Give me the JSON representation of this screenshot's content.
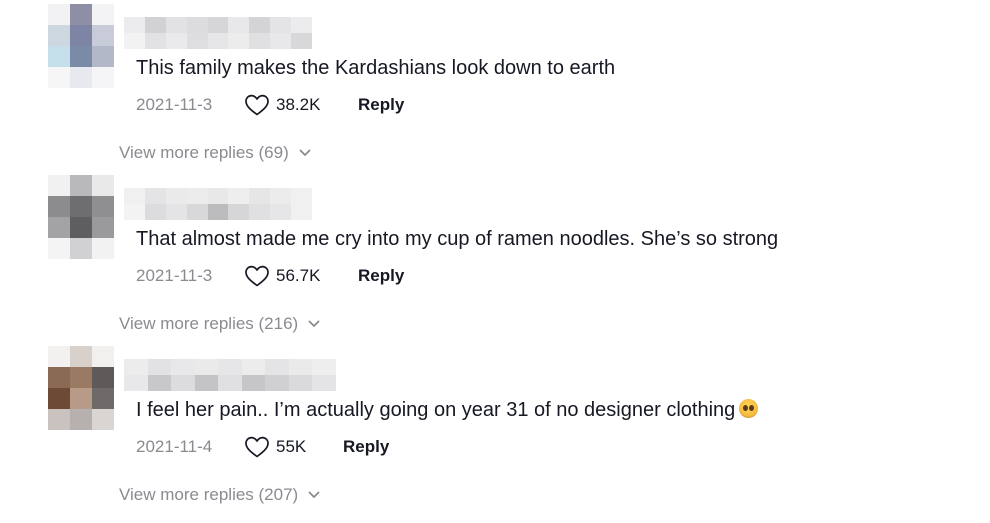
{
  "colors": {
    "text_primary": "#161823",
    "text_secondary": "#8a8b91",
    "background": "#ffffff"
  },
  "comments": [
    {
      "text": "This family makes the Kardashians look down to earth",
      "date": "2021-11-3",
      "likes": "38.2K",
      "reply_label": "Reply",
      "view_more_label": "View more replies (69)",
      "username_redacted": true,
      "avatar_redacted": true
    },
    {
      "text": "That almost made me cry into my cup of ramen noodles. She’s so strong",
      "date": "2021-11-3",
      "likes": "56.7K",
      "reply_label": "Reply",
      "view_more_label": "View more replies (216)",
      "username_redacted": true,
      "avatar_redacted": true
    },
    {
      "text": "I feel her pain.. I’m actually going on year 31 of no designer clothing",
      "emoji": "pleading-face",
      "date": "2021-11-4",
      "likes": "55K",
      "reply_label": "Reply",
      "view_more_label": "View more replies (207)",
      "username_redacted": true,
      "avatar_redacted": true
    }
  ],
  "icons": {
    "like": "heart-outline-icon",
    "expand": "chevron-down-icon"
  }
}
